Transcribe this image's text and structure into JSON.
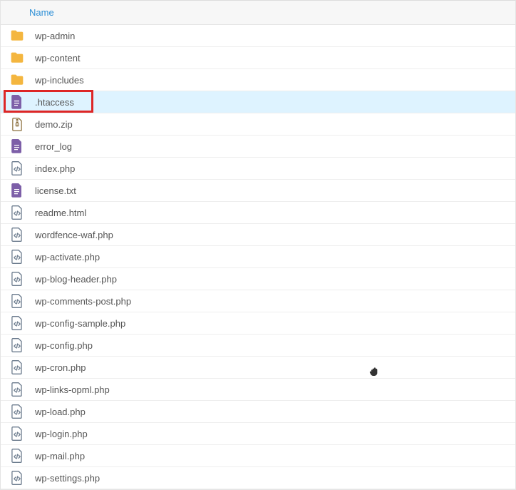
{
  "header": {
    "name_label": "Name"
  },
  "files": [
    {
      "name": "wp-admin",
      "type": "folder",
      "selected": false,
      "highlighted": false
    },
    {
      "name": "wp-content",
      "type": "folder",
      "selected": false,
      "highlighted": false
    },
    {
      "name": "wp-includes",
      "type": "folder",
      "selected": false,
      "highlighted": false
    },
    {
      "name": ".htaccess",
      "type": "text",
      "selected": true,
      "highlighted": true
    },
    {
      "name": "demo.zip",
      "type": "archive",
      "selected": false,
      "highlighted": false
    },
    {
      "name": "error_log",
      "type": "text",
      "selected": false,
      "highlighted": false
    },
    {
      "name": "index.php",
      "type": "code",
      "selected": false,
      "highlighted": false
    },
    {
      "name": "license.txt",
      "type": "text",
      "selected": false,
      "highlighted": false
    },
    {
      "name": "readme.html",
      "type": "code",
      "selected": false,
      "highlighted": false
    },
    {
      "name": "wordfence-waf.php",
      "type": "code",
      "selected": false,
      "highlighted": false
    },
    {
      "name": "wp-activate.php",
      "type": "code",
      "selected": false,
      "highlighted": false
    },
    {
      "name": "wp-blog-header.php",
      "type": "code",
      "selected": false,
      "highlighted": false
    },
    {
      "name": "wp-comments-post.php",
      "type": "code",
      "selected": false,
      "highlighted": false
    },
    {
      "name": "wp-config-sample.php",
      "type": "code",
      "selected": false,
      "highlighted": false
    },
    {
      "name": "wp-config.php",
      "type": "code",
      "selected": false,
      "highlighted": false
    },
    {
      "name": "wp-cron.php",
      "type": "code",
      "selected": false,
      "highlighted": false
    },
    {
      "name": "wp-links-opml.php",
      "type": "code",
      "selected": false,
      "highlighted": false
    },
    {
      "name": "wp-load.php",
      "type": "code",
      "selected": false,
      "highlighted": false
    },
    {
      "name": "wp-login.php",
      "type": "code",
      "selected": false,
      "highlighted": false
    },
    {
      "name": "wp-mail.php",
      "type": "code",
      "selected": false,
      "highlighted": false
    },
    {
      "name": "wp-settings.php",
      "type": "code",
      "selected": false,
      "highlighted": false
    }
  ]
}
